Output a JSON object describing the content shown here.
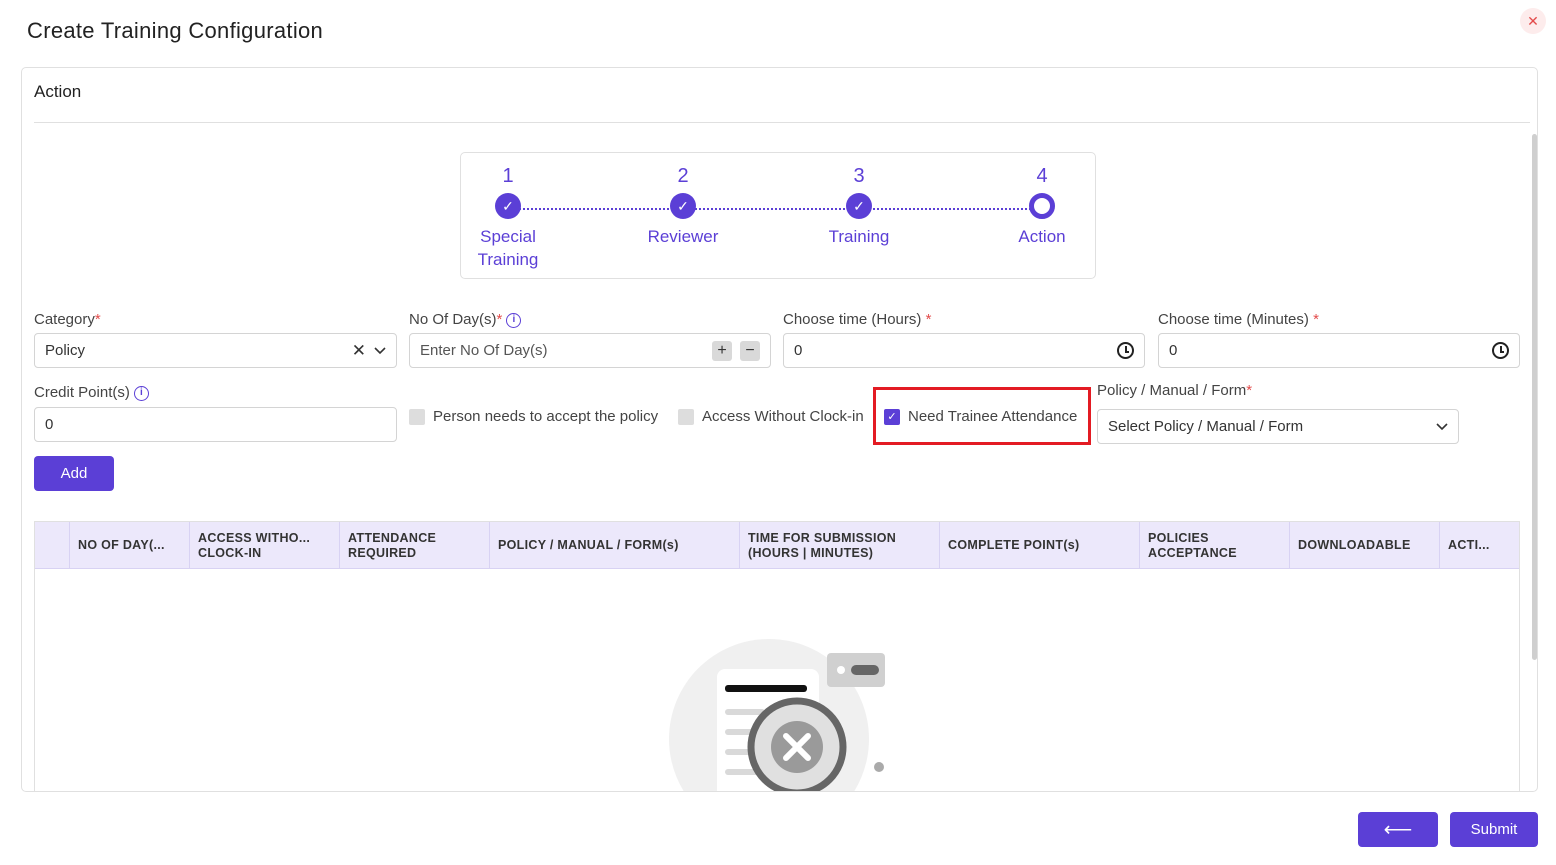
{
  "modal": {
    "title": "Create Training Configuration",
    "close_icon": "close-icon"
  },
  "card": {
    "header": "Action"
  },
  "stepper": {
    "steps": [
      {
        "number": "1",
        "label": "Special Training",
        "status": "completed"
      },
      {
        "number": "2",
        "label": "Reviewer",
        "status": "completed"
      },
      {
        "number": "3",
        "label": "Training",
        "status": "completed"
      },
      {
        "number": "4",
        "label": "Action",
        "status": "active"
      }
    ]
  },
  "form": {
    "category": {
      "label": "Category",
      "required": "*",
      "value": "Policy"
    },
    "no_of_days": {
      "label": "No Of Day(s)",
      "required": "*",
      "placeholder": "Enter No Of Day(s)"
    },
    "hours": {
      "label": "Choose time (Hours)",
      "required": "*",
      "value": "0"
    },
    "minutes": {
      "label": "Choose time (Minutes)",
      "required": "*",
      "value": "0"
    },
    "credit_points": {
      "label": "Credit Point(s)",
      "value": "0"
    },
    "accept_policy": {
      "label": "Person needs to accept the policy",
      "checked": false
    },
    "access_without_clockin": {
      "label": "Access Without Clock-in",
      "checked": false
    },
    "need_trainee_attendance": {
      "label": "Need Trainee Attendance",
      "checked": true
    },
    "policy_manual_form": {
      "label": "Policy / Manual / Form",
      "required": "*",
      "placeholder": "Select Policy / Manual / Form"
    },
    "add_label": "Add"
  },
  "table": {
    "columns": [
      "NO OF DAY(...",
      "ACCESS WITHO...\nCLOCK-IN",
      "ATTENDANCE\nREQUIRED",
      "POLICY / MANUAL / FORM(s)",
      "TIME FOR SUBMISSION\n(HOURS | MINUTES)",
      "COMPLETE POINT(s)",
      "POLICIES\nACCEPTANCE",
      "DOWNLOADABLE",
      "ACTI..."
    ],
    "rows": []
  },
  "footer": {
    "back_icon": "arrow-left-icon",
    "submit_label": "Submit"
  },
  "colors": {
    "accent": "#5b3fd6",
    "header_bg": "#ece8fb",
    "highlight": "#e31b23"
  }
}
